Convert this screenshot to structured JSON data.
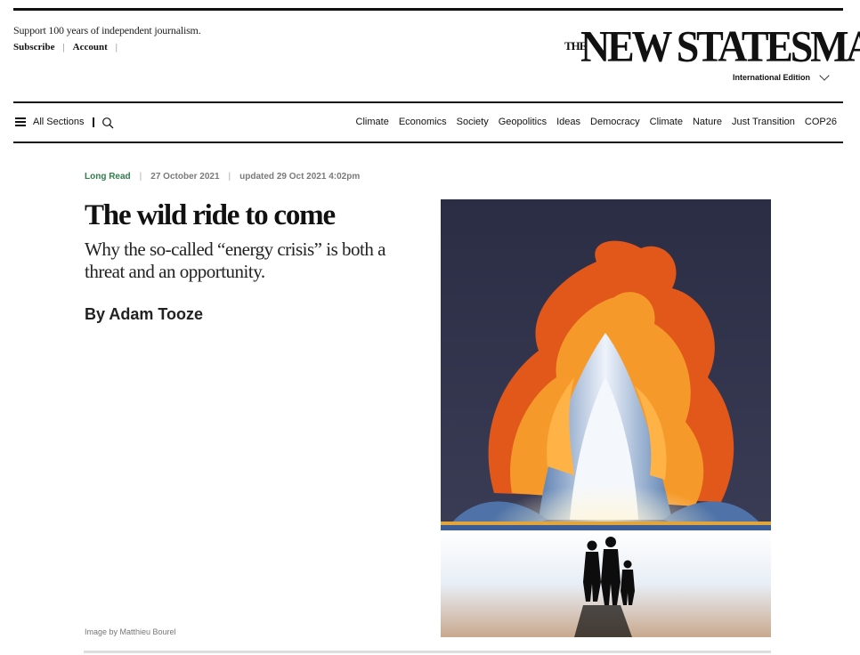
{
  "header": {
    "support_text": "Support 100 years of independent journalism.",
    "subscribe_label": "Subscribe",
    "account_label": "Account",
    "separator": "|",
    "masthead_the": "THE",
    "masthead_name": "NEW STATESMAN",
    "edition_label": "International Edition"
  },
  "nav": {
    "menu_label": "All Sections",
    "items": [
      "Climate",
      "Economics",
      "Society",
      "Geopolitics",
      "Ideas",
      "Democracy",
      "Climate",
      "Nature",
      "Just Transition",
      "COP26"
    ]
  },
  "article": {
    "category": "Long Read",
    "date": "27 October 2021",
    "updated": "updated 29 Oct 2021 4:02pm",
    "title": "The wild ride to come",
    "standfirst": "Why the so-called “energy crisis” is both a threat and an opportunity.",
    "byline": "By Adam Tooze",
    "image_credit": "Image by Matthieu Bourel"
  },
  "icons": {
    "menu": "hamburger-icon",
    "search": "search-icon",
    "edition": "chevron-down-icon"
  },
  "colors": {
    "category_green": "#2f7d4b",
    "hero_background": "#30324a",
    "flame_orange": "#f07a18"
  }
}
